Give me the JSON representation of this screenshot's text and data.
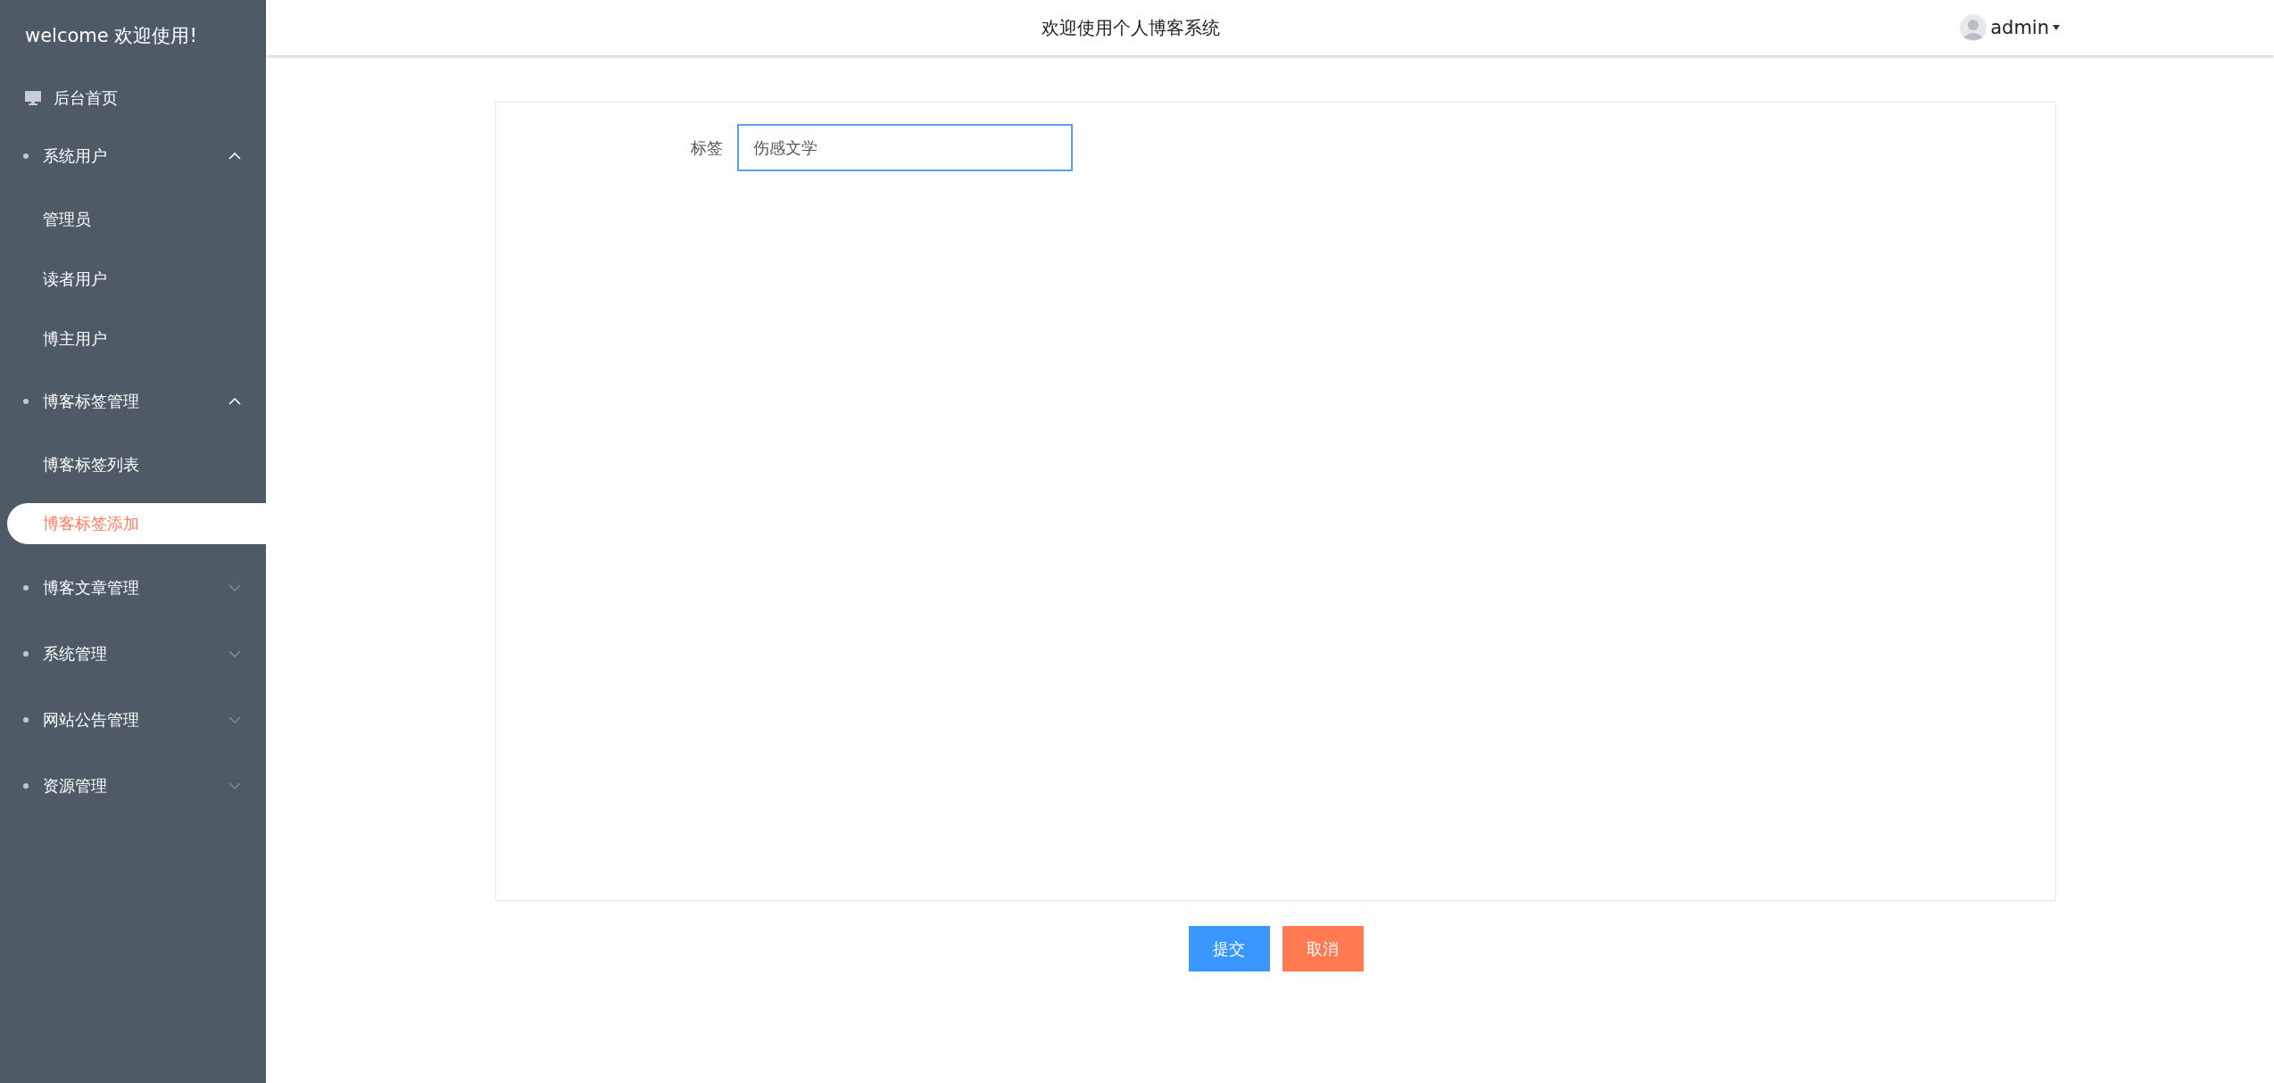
{
  "sidebar": {
    "title": "welcome 欢迎使用!",
    "items": [
      {
        "kind": "link",
        "label": "后台首页",
        "selected": false
      },
      {
        "kind": "group",
        "label": "系统用户",
        "expanded": true,
        "children": [
          {
            "label": "管理员",
            "selected": false
          },
          {
            "label": "读者用户",
            "selected": false
          },
          {
            "label": "博主用户",
            "selected": false
          }
        ]
      },
      {
        "kind": "group",
        "label": "博客标签管理",
        "expanded": true,
        "children": [
          {
            "label": "博客标签列表",
            "selected": false
          },
          {
            "label": "博客标签添加",
            "selected": true
          }
        ]
      },
      {
        "kind": "group",
        "label": "博客文章管理",
        "expanded": false
      },
      {
        "kind": "group",
        "label": "系统管理",
        "expanded": false
      },
      {
        "kind": "group",
        "label": "网站公告管理",
        "expanded": false
      },
      {
        "kind": "group",
        "label": "资源管理",
        "expanded": false
      }
    ]
  },
  "header": {
    "title": "欢迎使用个人博客系统",
    "user": "admin"
  },
  "form": {
    "fields": [
      {
        "label": "标签",
        "value": "伤感文学",
        "focused": true
      }
    ]
  },
  "buttons": [
    {
      "label": "提交",
      "kind": "primary"
    },
    {
      "label": "取消",
      "kind": "cancel"
    }
  ]
}
